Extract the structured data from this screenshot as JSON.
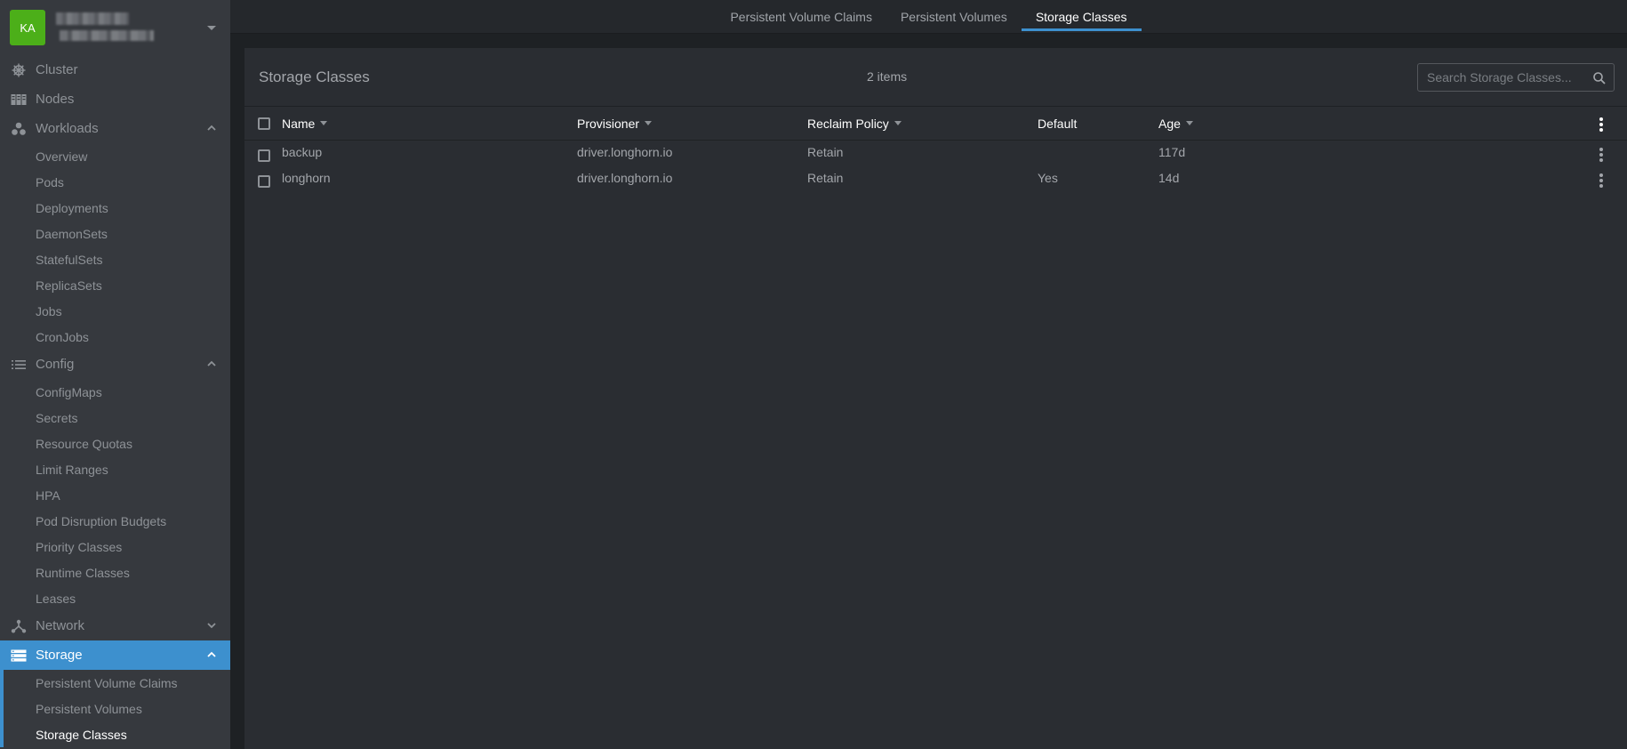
{
  "cluster": {
    "avatar_initials": "KA"
  },
  "sidebar": {
    "groups": [
      {
        "label": "Cluster",
        "icon": "cluster-helm-icon"
      },
      {
        "label": "Nodes",
        "icon": "nodes-icon"
      },
      {
        "label": "Workloads",
        "icon": "workloads-icon",
        "expanded": true,
        "items": [
          "Overview",
          "Pods",
          "Deployments",
          "DaemonSets",
          "StatefulSets",
          "ReplicaSets",
          "Jobs",
          "CronJobs"
        ]
      },
      {
        "label": "Config",
        "icon": "config-list-icon",
        "expanded": true,
        "items": [
          "ConfigMaps",
          "Secrets",
          "Resource Quotas",
          "Limit Ranges",
          "HPA",
          "Pod Disruption Budgets",
          "Priority Classes",
          "Runtime Classes",
          "Leases"
        ]
      },
      {
        "label": "Network",
        "icon": "network-icon",
        "expanded": false
      },
      {
        "label": "Storage",
        "icon": "storage-icon",
        "expanded": true,
        "active": true,
        "items": [
          "Persistent Volume Claims",
          "Persistent Volumes",
          "Storage Classes"
        ]
      }
    ]
  },
  "tabs": [
    "Persistent Volume Claims",
    "Persistent Volumes",
    "Storage Classes"
  ],
  "active_tab": "Storage Classes",
  "content": {
    "title": "Storage Classes",
    "count": "2 items",
    "search_placeholder": "Search Storage Classes..."
  },
  "table": {
    "columns": [
      "Name",
      "Provisioner",
      "Reclaim Policy",
      "Default",
      "Age"
    ],
    "rows": [
      {
        "name": "backup",
        "provisioner": "driver.longhorn.io",
        "reclaim": "Retain",
        "default": "",
        "age": "117d"
      },
      {
        "name": "longhorn",
        "provisioner": "driver.longhorn.io",
        "reclaim": "Retain",
        "default": "Yes",
        "age": "14d"
      }
    ]
  },
  "colors": {
    "accent": "#3d90ce",
    "avatar": "#4caf19"
  }
}
